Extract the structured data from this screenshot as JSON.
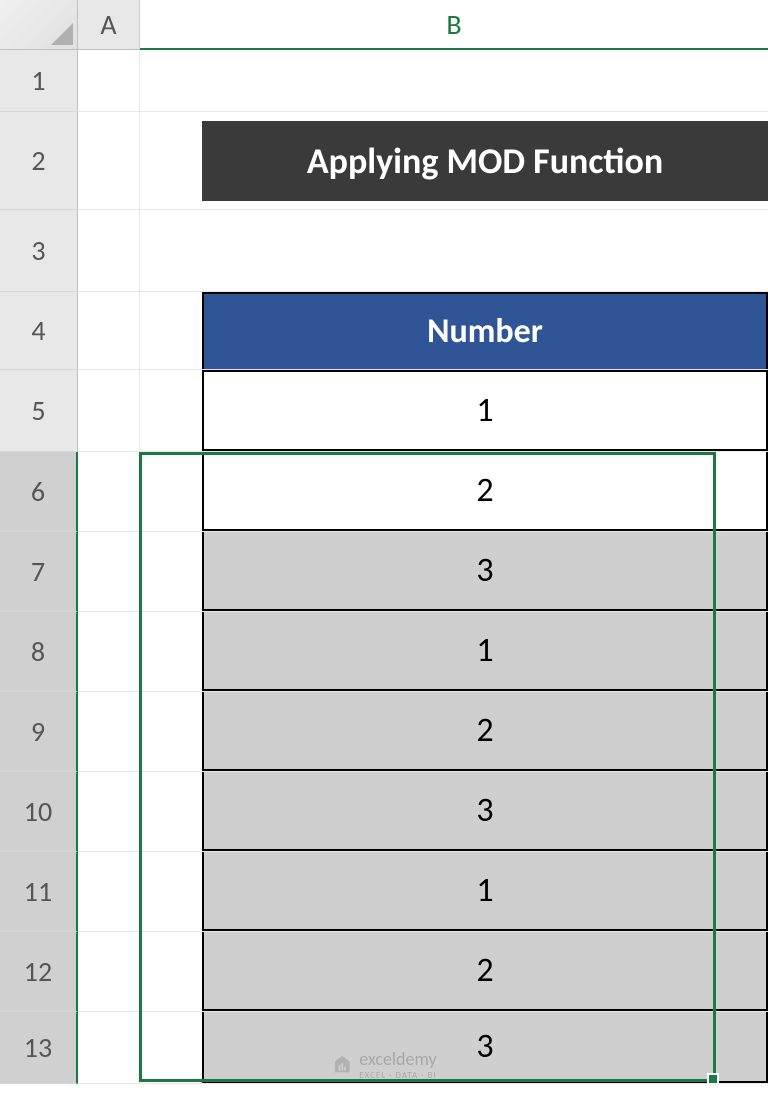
{
  "columns": {
    "A": "A",
    "B": "B"
  },
  "rows": [
    "1",
    "2",
    "3",
    "4",
    "5",
    "6",
    "7",
    "8",
    "9",
    "10",
    "11",
    "12",
    "13"
  ],
  "title": "Applying MOD Function",
  "table": {
    "header": "Number",
    "values": [
      "1",
      "2",
      "3",
      "1",
      "2",
      "3",
      "1",
      "2",
      "3"
    ]
  },
  "watermark": {
    "brand": "exceldemy",
    "tagline": "EXCEL · DATA · BI"
  }
}
